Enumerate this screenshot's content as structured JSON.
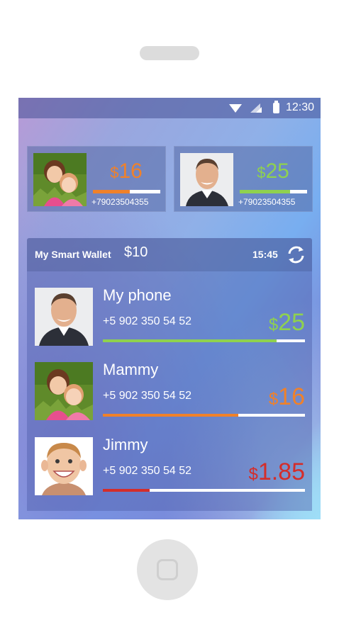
{
  "status_bar": {
    "time": "12:30"
  },
  "quick_cards": [
    {
      "amount": "16",
      "currency": "$",
      "phone": "+79023504355",
      "color": "#f0812a",
      "level": 0.55
    },
    {
      "amount": "25",
      "currency": "$",
      "phone": "+79023504355",
      "color": "#8fd14f",
      "level": 0.75
    }
  ],
  "wallet": {
    "title": "My Smart Wallet",
    "balance": "$10",
    "time": "15:45",
    "items": [
      {
        "name": "My phone",
        "phone": "+5 902 350 54 52",
        "currency": "$",
        "amount": "25",
        "color": "#8fd14f",
        "level": 0.86
      },
      {
        "name": "Mammy",
        "phone": "+5 902 350 54 52",
        "currency": "$",
        "amount": "16",
        "color": "#f0812a",
        "level": 0.67
      },
      {
        "name": "Jimmy",
        "phone": "+5 902 350 54 52",
        "currency": "$",
        "amount": "1.85",
        "color": "#d42d2a",
        "level": 0.23
      }
    ]
  }
}
